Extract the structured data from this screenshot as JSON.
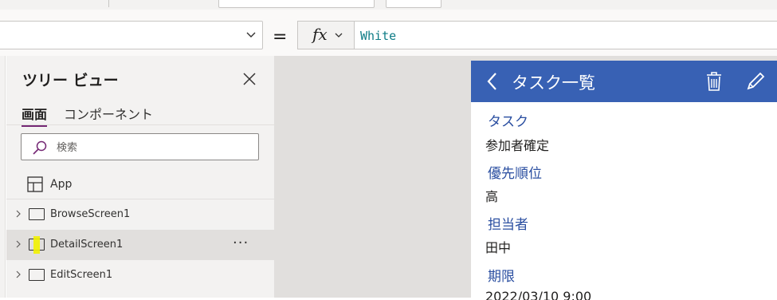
{
  "formula": {
    "equals": "=",
    "fx_label": "fx",
    "value": "White"
  },
  "tree_view": {
    "title": "ツリー ビュー",
    "tabs": [
      {
        "label": "画面",
        "active": true
      },
      {
        "label": "コンポーネント",
        "active": false
      }
    ],
    "search_placeholder": "検索",
    "app_label": "App",
    "screens": [
      {
        "label": "BrowseScreen1",
        "selected": false
      },
      {
        "label": "DetailScreen1",
        "selected": true
      },
      {
        "label": "EditScreen1",
        "selected": false
      }
    ],
    "more_label": "···"
  },
  "app_screen": {
    "title": "タスク一覧",
    "header_color": "#3861b4",
    "fields": [
      {
        "label": "タスク",
        "value": "参加者確定"
      },
      {
        "label": "優先順位",
        "value": "高"
      },
      {
        "label": "担当者",
        "value": "田中"
      },
      {
        "label": "期限",
        "value": "2022/03/10 9:00"
      }
    ]
  },
  "colors": {
    "accent_purple": "#742774",
    "formula_text": "#0e7c86",
    "field_label": "#2b4fa1",
    "highlight_yellow": "#f2f200"
  }
}
